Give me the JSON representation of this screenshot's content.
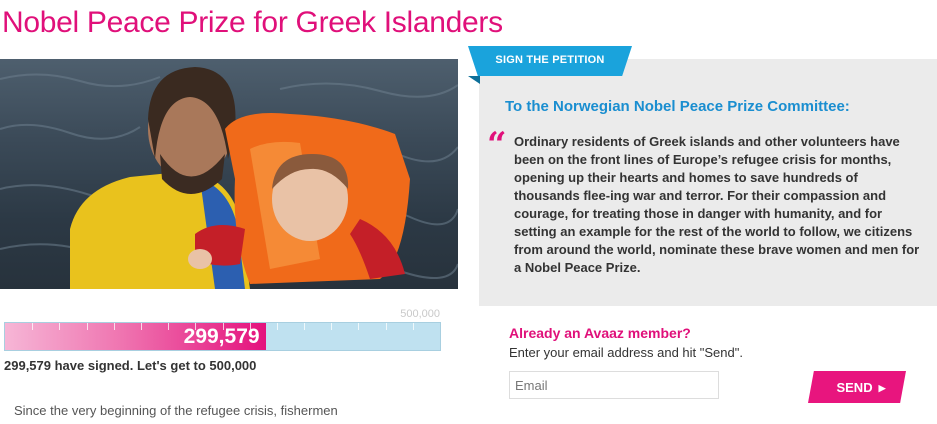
{
  "page": {
    "title": "Nobel Peace Prize for Greek Islanders"
  },
  "photo": {
    "description_icon": "photo-rescuer-holding-child"
  },
  "progress": {
    "count": "299,579",
    "goal": "500,000",
    "fraction": 0.599,
    "signed_text": "299,579 have signed. Let's get to 500,000"
  },
  "teaser": {
    "text": "Since the very beginning of the refugee crisis, fishermen"
  },
  "petition": {
    "ribbon_label": "SIGN THE PETITION",
    "addressee": "To the Norwegian Nobel Peace Prize Committee:",
    "quote_glyph": "“",
    "body": "Ordinary residents of Greek islands and other volunteers have been on the front lines of Europe’s refugee crisis for months, opening up their hearts and homes to save hundreds of thousands flee-ing war and terror. For their compassion and courage, for treating those in danger with humanity, and for setting an example for the rest of the world to follow, we citizens from around the world, nominate these brave women and men for a Nobel Peace Prize."
  },
  "signup": {
    "member_question": "Already an Avaaz member?",
    "instructions": "Enter your email address and hit \"Send\".",
    "email_placeholder": "Email",
    "send_label": "SEND",
    "send_arrow": "▶"
  },
  "colors": {
    "brand_pink": "#e0107a",
    "accent_blue": "#1aa3dc",
    "panel_gray": "#ebebeb"
  }
}
